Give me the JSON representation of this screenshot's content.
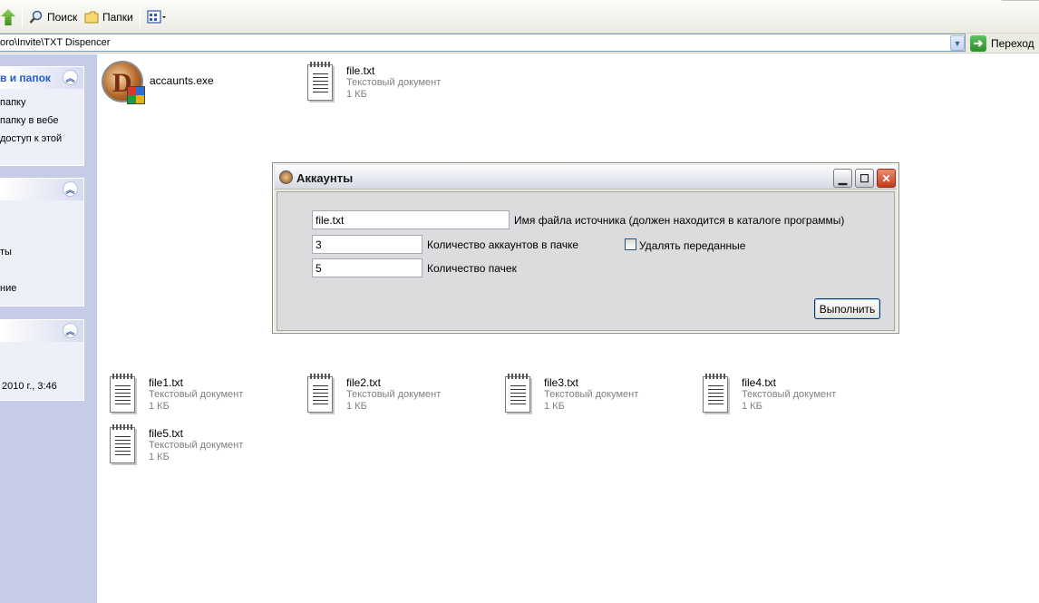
{
  "toolbar": {
    "search_label": "Поиск",
    "folders_label": "Папки"
  },
  "address": {
    "path": "oro\\Invite\\TXT Dispencer",
    "go_label": "Переход"
  },
  "taskpane": {
    "panel1": {
      "title": "в и папок",
      "items": [
        "папку",
        "папку в вебе",
        "доступ к этой"
      ]
    },
    "panel2": {
      "items": [
        "ты",
        "ние"
      ]
    },
    "panel3": {
      "items": [
        "2010 г., 3:46"
      ]
    }
  },
  "files": [
    {
      "name": "accaunts.exe"
    },
    {
      "name": "file.txt",
      "type": "Текстовый документ",
      "size": "1 КБ"
    },
    {
      "name": "file1.txt",
      "type": "Текстовый документ",
      "size": "1 КБ"
    },
    {
      "name": "file2.txt",
      "type": "Текстовый документ",
      "size": "1 КБ"
    },
    {
      "name": "file3.txt",
      "type": "Текстовый документ",
      "size": "1 КБ"
    },
    {
      "name": "file4.txt",
      "type": "Текстовый документ",
      "size": "1 КБ"
    },
    {
      "name": "file5.txt",
      "type": "Текстовый документ",
      "size": "1 КБ"
    }
  ],
  "dialog": {
    "title": "Аккаунты",
    "source_file_value": "file.txt",
    "source_file_label": "Имя файла источника (должен находится в каталоге программы)",
    "accounts_value": "3",
    "accounts_label": "Количество аккаунтов в пачке",
    "delete_label": "Удалять переданные",
    "delete_checked": false,
    "packs_value": "5",
    "packs_label": "Количество пачек",
    "run_label": "Выполнить"
  },
  "icons": [
    "back-arrow-icon",
    "search-icon",
    "folders-icon",
    "view-icon",
    "go-arrow-icon",
    "chevron-up-icon",
    "text-file-icon",
    "exe-app-icon",
    "minimize-icon",
    "maximize-icon",
    "close-icon"
  ],
  "colors": {
    "taskpane": "#c6cbe8",
    "panel_title": "#215dc6",
    "close_button": "#c23a1c",
    "go_arrow": "#2a8d2a"
  }
}
